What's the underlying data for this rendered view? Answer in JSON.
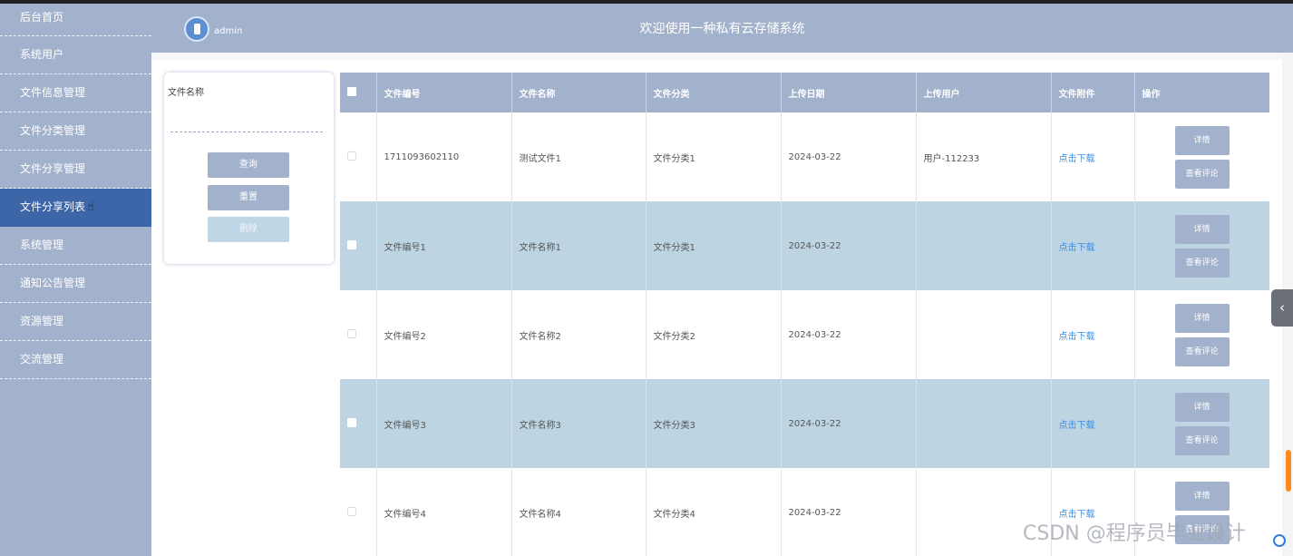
{
  "header": {
    "admin": "admin",
    "title": "欢迎使用一种私有云存储系统"
  },
  "sidebar": {
    "items": [
      {
        "label": "后台首页"
      },
      {
        "label": "系统用户"
      },
      {
        "label": "文件信息管理"
      },
      {
        "label": "文件分类管理"
      },
      {
        "label": "文件分享管理"
      },
      {
        "label": "文件分享列表",
        "active": true
      },
      {
        "label": "系统管理"
      },
      {
        "label": "通知公告管理"
      },
      {
        "label": "资源管理"
      },
      {
        "label": "交流管理"
      }
    ]
  },
  "search": {
    "label": "文件名称",
    "value": "",
    "buttons": {
      "query": "查询",
      "reset": "重置",
      "delete": "删除"
    }
  },
  "table": {
    "headers": [
      "文件编号",
      "文件名称",
      "文件分类",
      "上传日期",
      "上传用户",
      "文件附件",
      "操作"
    ],
    "rows": [
      {
        "id": "1711093602110",
        "name": "测试文件1",
        "category": "文件分类1",
        "date": "2024-03-22",
        "user": "用户-112233",
        "attachment": "点击下载"
      },
      {
        "id": "文件编号1",
        "name": "文件名称1",
        "category": "文件分类1",
        "date": "2024-03-22",
        "user": "",
        "attachment": "点击下载"
      },
      {
        "id": "文件编号2",
        "name": "文件名称2",
        "category": "文件分类2",
        "date": "2024-03-22",
        "user": "",
        "attachment": "点击下载"
      },
      {
        "id": "文件编号3",
        "name": "文件名称3",
        "category": "文件分类3",
        "date": "2024-03-22",
        "user": "",
        "attachment": "点击下载"
      },
      {
        "id": "文件编号4",
        "name": "文件名称4",
        "category": "文件分类4",
        "date": "2024-03-22",
        "user": "",
        "attachment": "点击下载"
      }
    ],
    "actions": {
      "detail": "详情",
      "comments": "查看评论"
    }
  },
  "watermark": "CSDN @程序员毕业设计",
  "colors": {
    "primary": "#a3b2cc",
    "active_nav": "#3d66a8",
    "row_alt": "#bdd5e3",
    "link": "#3a8ee6"
  }
}
